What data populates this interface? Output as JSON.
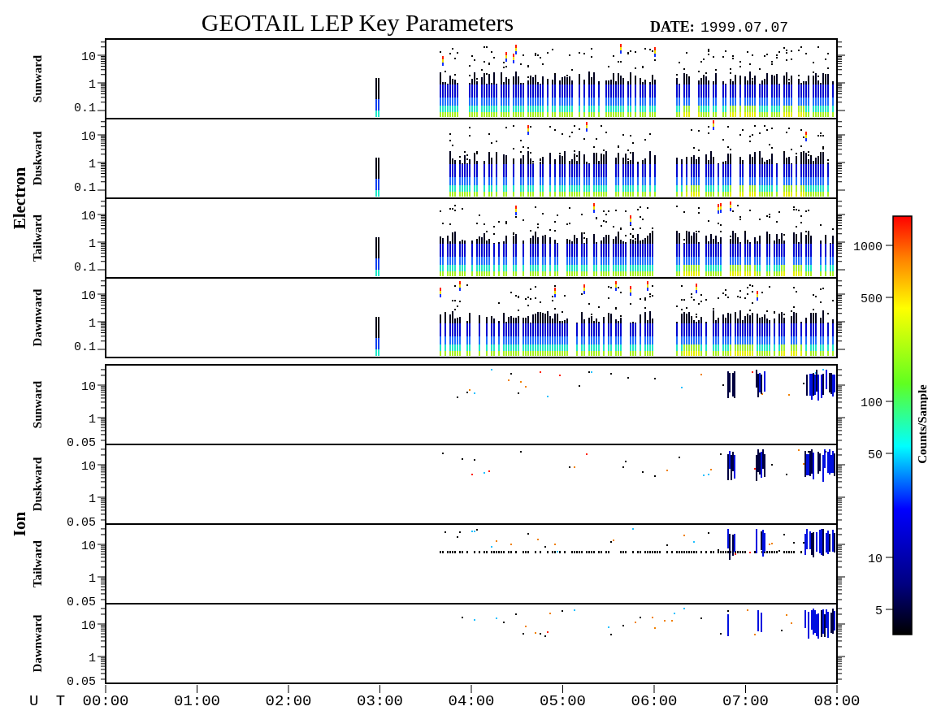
{
  "title": "GEOTAIL LEP Key Parameters",
  "date": {
    "label": "DATE:",
    "value": "1999.07.07"
  },
  "groups": [
    {
      "label": "Electron",
      "kind": "electron",
      "panels": [
        {
          "label": "Sunward",
          "yticks": [
            "10",
            "1",
            "0.1"
          ]
        },
        {
          "label": "Duskward",
          "yticks": [
            "10",
            "1",
            "0.1"
          ]
        },
        {
          "label": "Tailward",
          "yticks": [
            "10",
            "1",
            "0.1"
          ]
        },
        {
          "label": "Dawnward",
          "yticks": [
            "10",
            "1",
            "0.1"
          ]
        }
      ]
    },
    {
      "label": "Ion",
      "kind": "ion",
      "panels": [
        {
          "label": "Sunward",
          "yticks": [
            "10",
            "1",
            "0.05"
          ]
        },
        {
          "label": "Duskward",
          "yticks": [
            "10",
            "1",
            "0.05"
          ]
        },
        {
          "label": "Tailward",
          "yticks": [
            "10",
            "1",
            "0.05"
          ]
        },
        {
          "label": "Dawnward",
          "yticks": [
            "10",
            "1",
            "0.05"
          ]
        }
      ]
    }
  ],
  "x_axis": {
    "label": "U T",
    "ticks": [
      "00:00",
      "01:00",
      "02:00",
      "03:00",
      "04:00",
      "05:00",
      "06:00",
      "07:00",
      "08:00"
    ]
  },
  "colorbar": {
    "label": "Counts/Sample",
    "ticks": [
      "1000",
      "500",
      "100",
      "50",
      "10",
      "5"
    ]
  }
}
